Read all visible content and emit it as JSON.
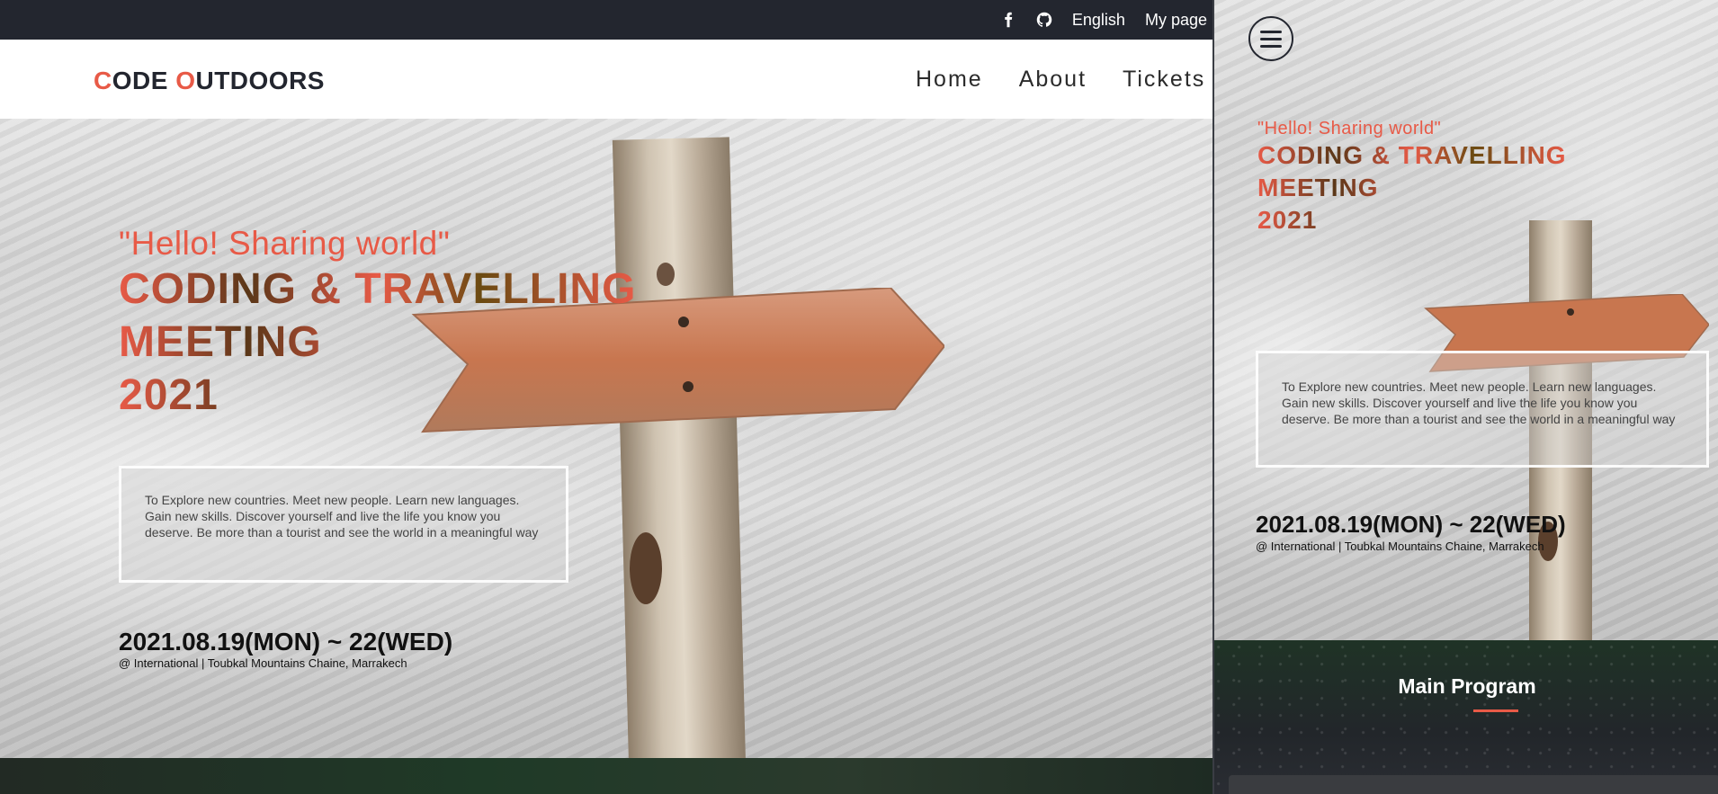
{
  "topbar": {
    "facebook_icon": "facebook-icon",
    "github_icon": "github-icon",
    "language": "English",
    "mypage": "My page"
  },
  "brand": {
    "logo_first_letter": "C",
    "logo_first_rest": "ODE ",
    "logo_second_letter": "O",
    "logo_second_rest": "UTDOORS"
  },
  "nav": {
    "home": "Home",
    "about": "About",
    "tickets": "Tickets"
  },
  "hero": {
    "tagline": "\"Hello! Sharing world\"",
    "headline_line1": "CODING & TRAVELLING",
    "headline_line2": "MEETING",
    "headline_line3": "2021",
    "description": "To Explore new countries. Meet new people. Learn new languages. Gain new skills. Discover yourself and live the life you know you deserve. Be more than a tourist and see the world in a meaningful way",
    "date": "2021.08.19(MON) ~ 22(WED)",
    "location": "@ International | Toubkal Mountains Chaine, Marrakech"
  },
  "mobile": {
    "menu_icon": "hamburger-menu-icon",
    "program_title": "Main Program"
  },
  "colors": {
    "accent": "#e85a47",
    "dark": "#23262f"
  }
}
